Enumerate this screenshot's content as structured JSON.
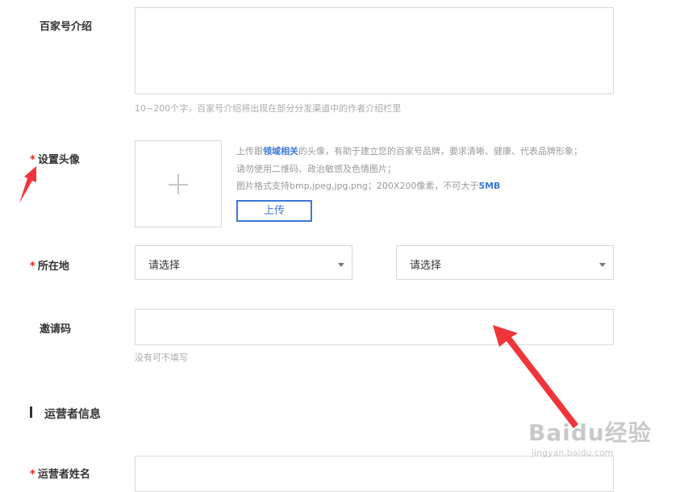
{
  "intro": {
    "label": "百家号介绍",
    "hint": "10~200个字，百家号介绍将出现在部分分发渠道中的作者介绍栏里"
  },
  "avatar": {
    "required_mark": "*",
    "label": "设置头像",
    "line1_prefix": "上传跟",
    "line1_link": "领域相关",
    "line1_suffix": "的头像，有助于建立您的百家号品牌，要求清晰、健康、代表品牌形象；",
    "line2": "请勿使用二维码、政治敏感及色情图片；",
    "line3_prefix": "图片格式支持bmp,jpeg,jpg,png；200X200像素，不可大于",
    "line3_size": "5MB",
    "upload_label": "上传"
  },
  "location": {
    "required_mark": "*",
    "label": "所在地",
    "select1": "请选择",
    "select2": "请选择"
  },
  "invite": {
    "label": "邀请码",
    "value": "",
    "hint": "没有可不填写"
  },
  "operator_section": {
    "title": "运营者信息"
  },
  "operator_name": {
    "required_mark": "*",
    "label": "运营者姓名",
    "value": ""
  },
  "watermark": {
    "main": "Baidu经验",
    "sub": "jingyan.baidu.com"
  },
  "colors": {
    "required": "#e2291c",
    "accent_blue": "#3c78d8",
    "annotation_arrow": "#f0353a"
  }
}
